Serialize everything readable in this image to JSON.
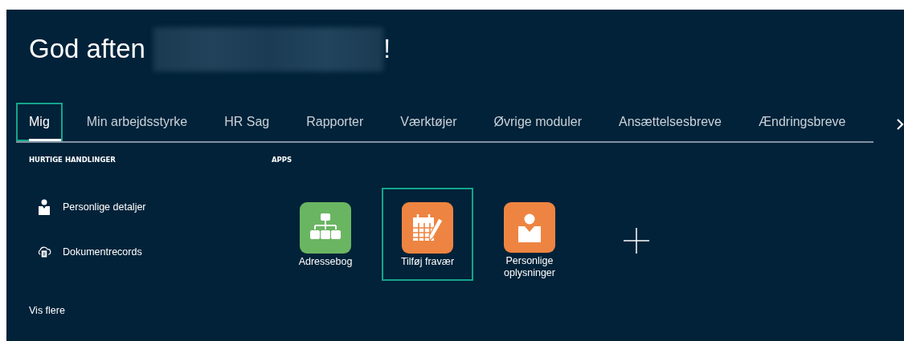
{
  "greeting": {
    "text": "God aften",
    "name_redacted": true,
    "suffix": "!"
  },
  "tabs": [
    {
      "label": "Mig",
      "selected": true,
      "highlighted": true
    },
    {
      "label": "Min arbejdsstyrke",
      "selected": false,
      "highlighted": false
    },
    {
      "label": "HR Sag",
      "selected": false,
      "highlighted": false
    },
    {
      "label": "Rapporter",
      "selected": false,
      "highlighted": false
    },
    {
      "label": "Værktøjer",
      "selected": false,
      "highlighted": false
    },
    {
      "label": "Øvrige moduler",
      "selected": false,
      "highlighted": false
    },
    {
      "label": "Ansættelsesbreve",
      "selected": false,
      "highlighted": false
    },
    {
      "label": "Ændringsbreve",
      "selected": false,
      "highlighted": false
    }
  ],
  "quick_actions": {
    "heading": "HURTIGE HANDLINGER",
    "items": [
      {
        "label": "Personlige detaljer",
        "kind": "person"
      },
      {
        "label": "Dokumentrecords",
        "kind": "cloud-document"
      }
    ],
    "more_link": "Vis flere"
  },
  "apps": {
    "heading": "APPS",
    "items": [
      {
        "label": "Adressebog",
        "kind": "org-chart",
        "color": "#6ab562",
        "highlighted": false
      },
      {
        "label": "Tilføj fravær",
        "kind": "calendar-edit",
        "color": "#ee8441",
        "highlighted": true
      },
      {
        "label": "Personlige oplysninger",
        "kind": "person",
        "color": "#ee8441",
        "highlighted": false
      }
    ],
    "add_button": true
  }
}
